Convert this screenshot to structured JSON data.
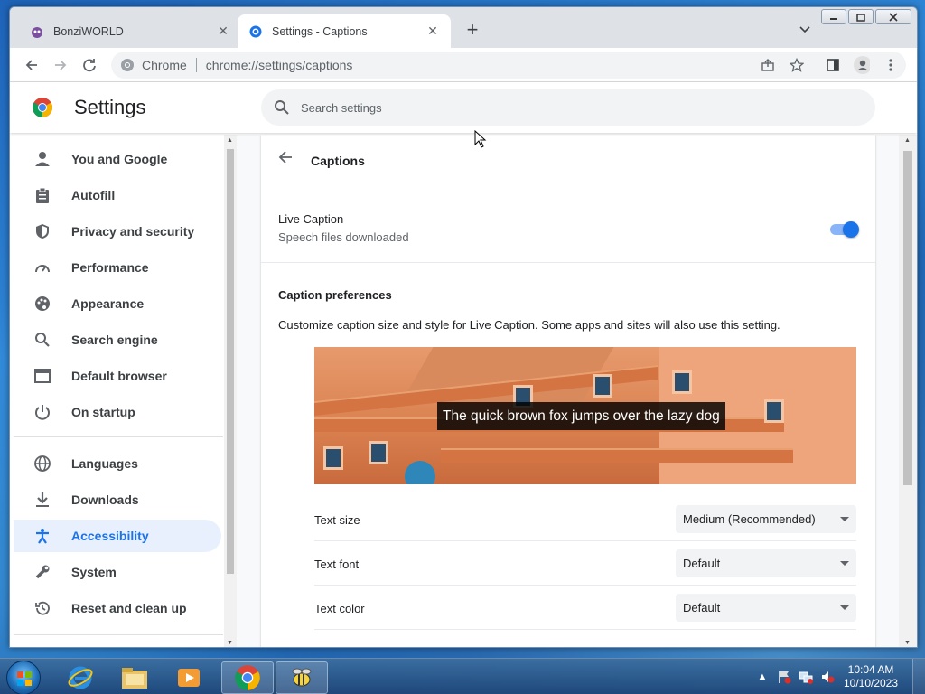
{
  "browser": {
    "tabs": [
      {
        "title": "BonziWORLD",
        "active": false
      },
      {
        "title": "Settings - Captions",
        "active": true
      }
    ],
    "omnibox": {
      "chip": "Chrome",
      "url": "chrome://settings/captions"
    }
  },
  "settings": {
    "title": "Settings",
    "search_placeholder": "Search settings",
    "nav": [
      {
        "label": "You and Google",
        "icon": "person-icon"
      },
      {
        "label": "Autofill",
        "icon": "clipboard-icon"
      },
      {
        "label": "Privacy and security",
        "icon": "shield-icon"
      },
      {
        "label": "Performance",
        "icon": "speedometer-icon"
      },
      {
        "label": "Appearance",
        "icon": "palette-icon"
      },
      {
        "label": "Search engine",
        "icon": "search-icon"
      },
      {
        "label": "Default browser",
        "icon": "browser-window-icon"
      },
      {
        "label": "On startup",
        "icon": "power-icon"
      },
      {
        "label": "Languages",
        "icon": "globe-icon"
      },
      {
        "label": "Downloads",
        "icon": "download-icon"
      },
      {
        "label": "Accessibility",
        "icon": "accessibility-icon",
        "active": true
      },
      {
        "label": "System",
        "icon": "wrench-icon"
      },
      {
        "label": "Reset and clean up",
        "icon": "history-icon"
      }
    ],
    "captions": {
      "subpage_title": "Captions",
      "live_caption_label": "Live Caption",
      "live_caption_sub": "Speech files downloaded",
      "live_caption_on": true,
      "section_title": "Caption preferences",
      "description": "Customize caption size and style for Live Caption. Some apps and sites will also use this setting.",
      "preview_text": "The quick brown fox jumps over the lazy dog",
      "prefs": [
        {
          "label": "Text size",
          "value": "Medium (Recommended)"
        },
        {
          "label": "Text font",
          "value": "Default"
        },
        {
          "label": "Text color",
          "value": "Default"
        }
      ]
    }
  },
  "taskbar": {
    "time": "10:04 AM",
    "date": "10/10/2023"
  },
  "colors": {
    "accent": "#1a73e8",
    "active_nav_bg": "#e8f0fe"
  }
}
